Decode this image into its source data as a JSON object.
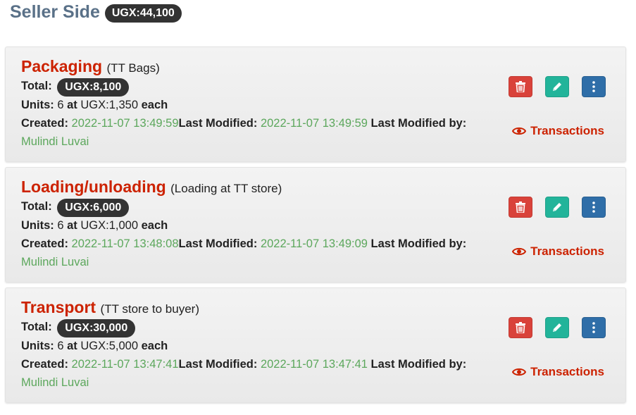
{
  "header": {
    "title": "Seller Side",
    "total_badge": "UGX:44,100"
  },
  "labels": {
    "total": "Total:",
    "units": "Units:",
    "at": "at",
    "each": "each",
    "created": "Created:",
    "last_modified": "Last Modified:",
    "last_modified_by": "Last Modified by:",
    "transactions": "Transactions"
  },
  "icons": {
    "delete": "trash-icon",
    "edit": "pencil-icon",
    "more": "vertical-dots-icon",
    "view": "eye-icon"
  },
  "colors": {
    "title": "#5a7188",
    "item_name": "#cc2200",
    "date": "#5ca75c",
    "delete_button": "#d9423a",
    "edit_button": "#22b49a",
    "more_button": "#2f6ea8",
    "badge": "#333333"
  },
  "items": [
    {
      "name": "Packaging",
      "description": "(TT Bags)",
      "total": "UGX:8,100",
      "units": "6",
      "unit_price": "UGX:1,350",
      "created": "2022-11-07 13:49:59",
      "last_modified": "2022-11-07 13:49:59",
      "last_modified_by": "Mulindi Luvai"
    },
    {
      "name": "Loading/unloading",
      "description": "(Loading at TT store)",
      "total": "UGX:6,000",
      "units": "6",
      "unit_price": "UGX:1,000",
      "created": "2022-11-07 13:48:08",
      "last_modified": "2022-11-07 13:49:09",
      "last_modified_by": "Mulindi Luvai"
    },
    {
      "name": "Transport",
      "description": "(TT store to buyer)",
      "total": "UGX:30,000",
      "units": "6",
      "unit_price": "UGX:5,000",
      "created": "2022-11-07 13:47:41",
      "last_modified": "2022-11-07 13:47:41",
      "last_modified_by": "Mulindi Luvai"
    }
  ]
}
